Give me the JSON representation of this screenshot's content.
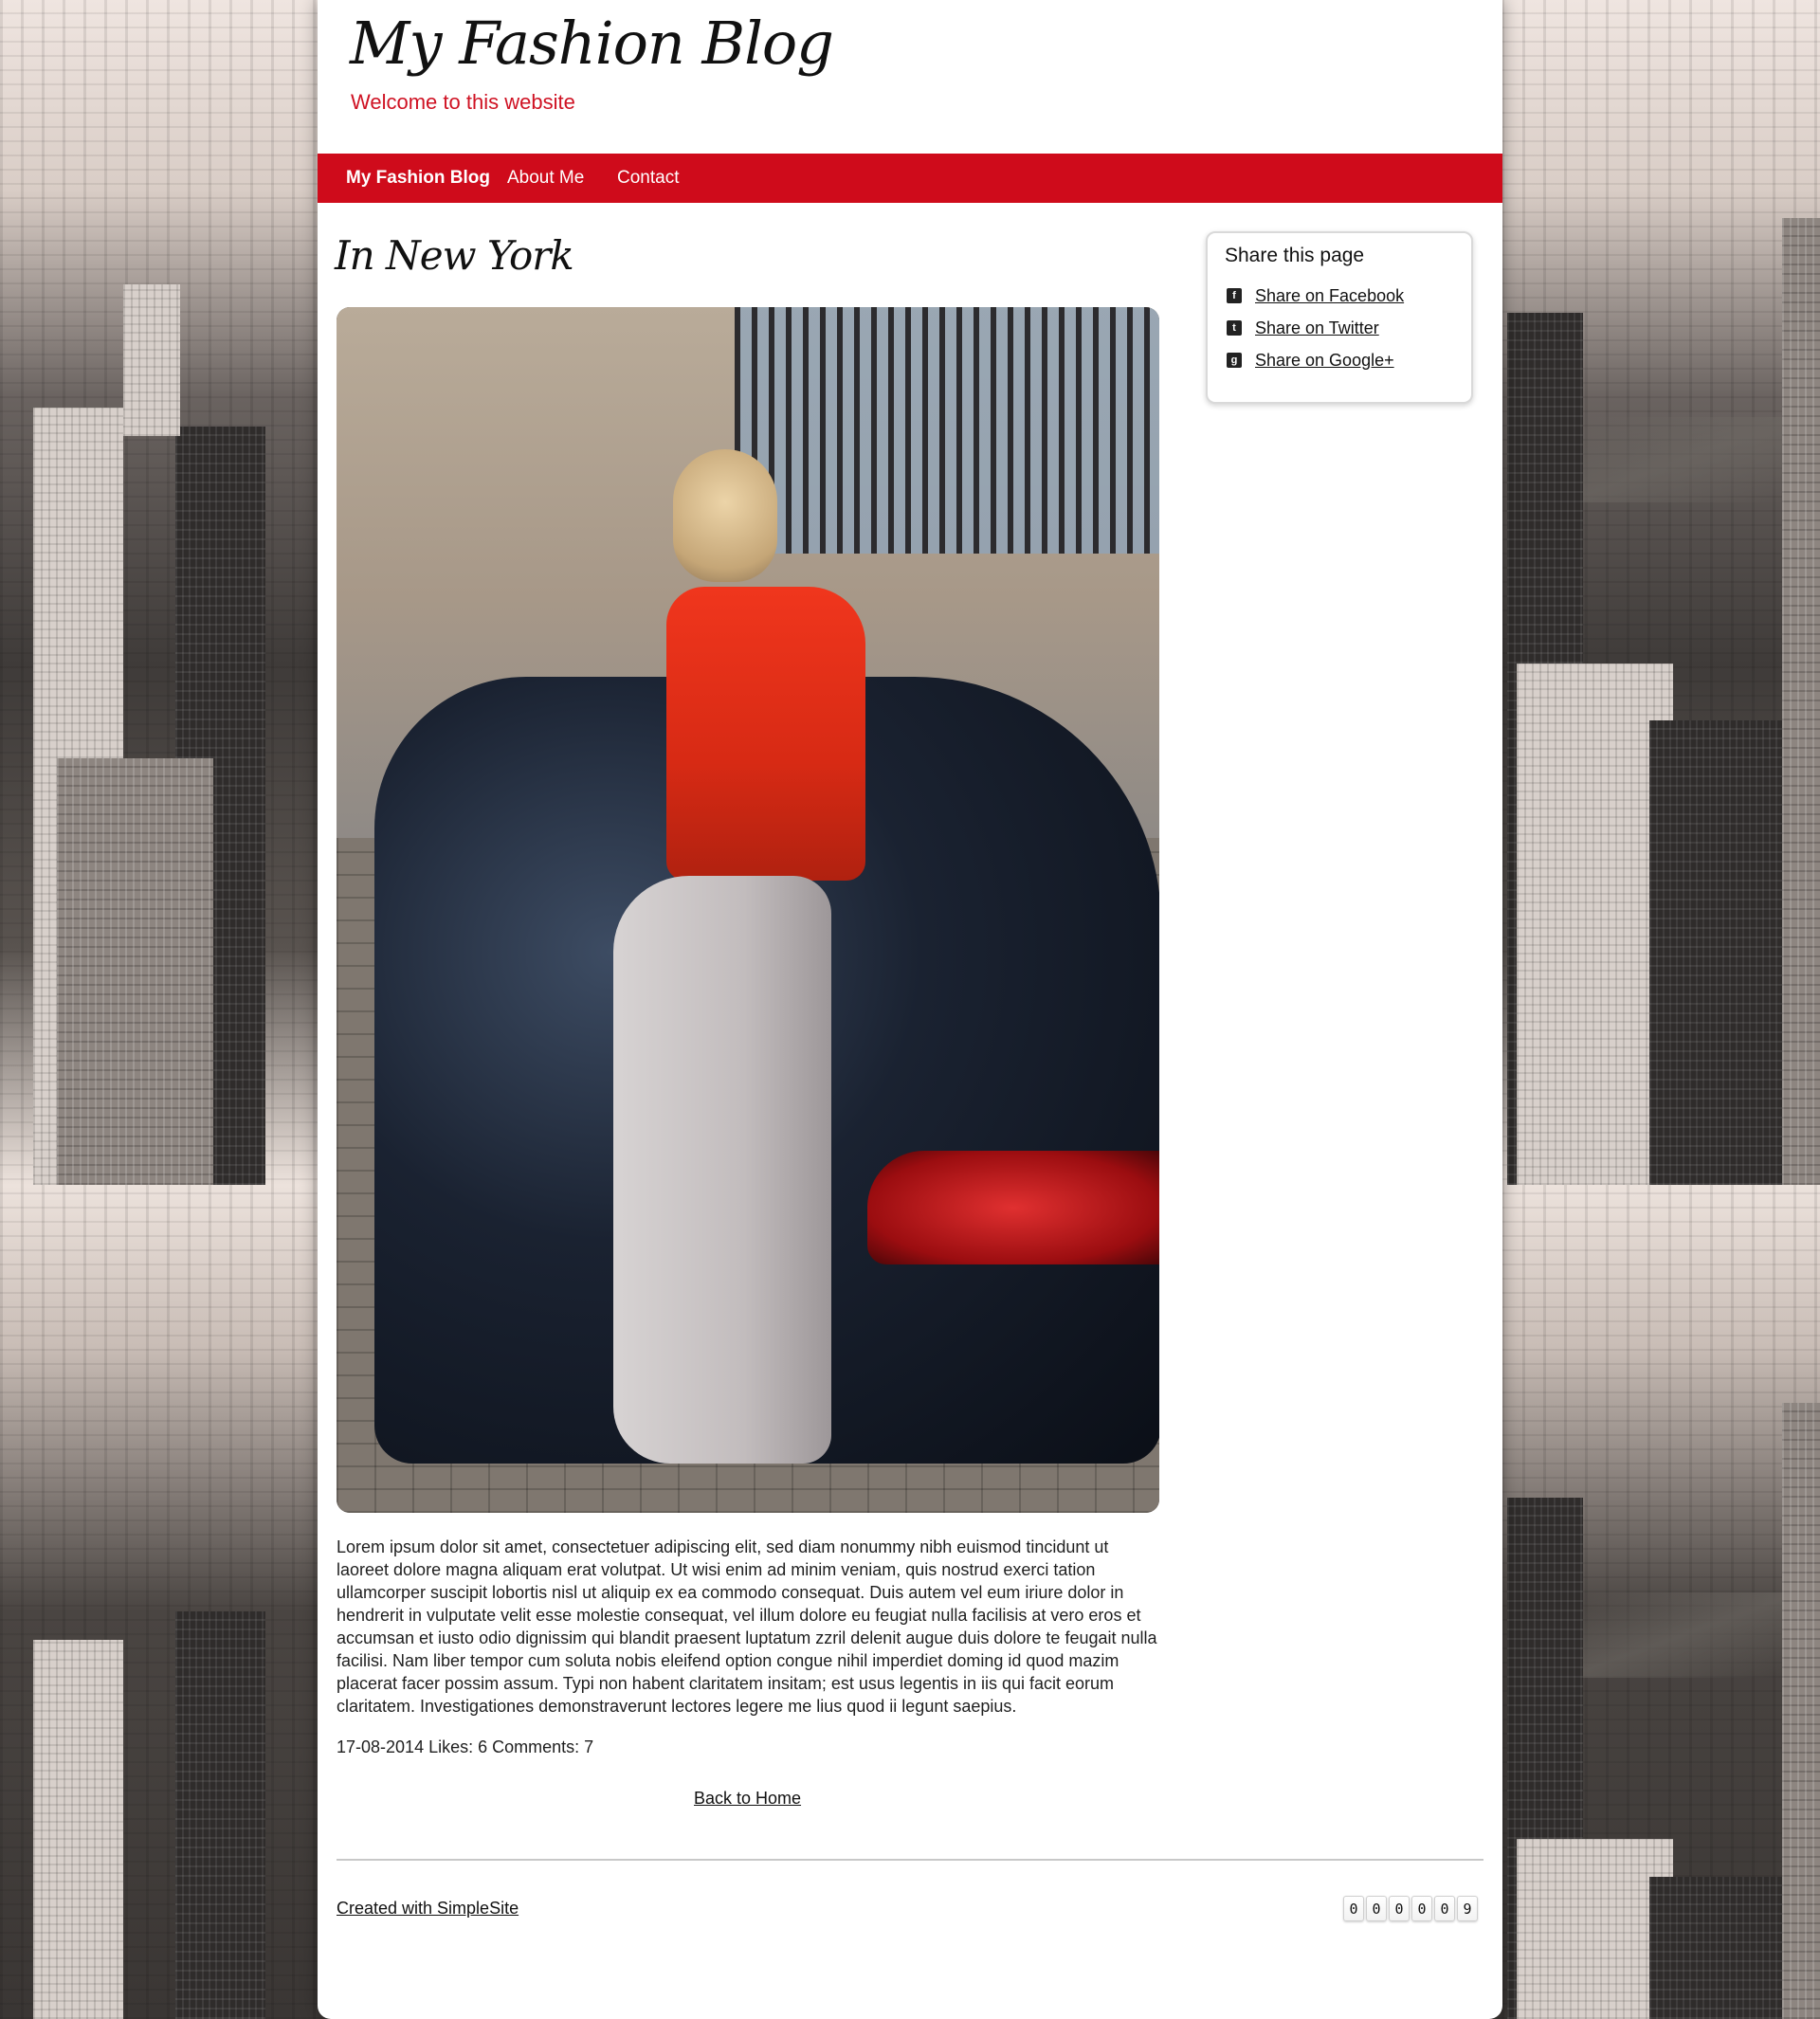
{
  "header": {
    "site_title": "My Fashion Blog",
    "subtitle": "Welcome to this website"
  },
  "nav": {
    "items": [
      {
        "label": "My Fashion Blog",
        "active": true
      },
      {
        "label": "About Me",
        "active": false
      },
      {
        "label": "Contact",
        "active": false
      }
    ]
  },
  "post": {
    "title": "In New York",
    "body": "Lorem ipsum dolor sit amet, consectetuer adipiscing elit, sed diam nonummy nibh euismod tincidunt ut laoreet dolore magna aliquam erat volutpat. Ut wisi enim ad minim veniam, quis nostrud exerci tation ullamcorper suscipit lobortis nisl ut aliquip ex ea commodo consequat. Duis autem vel eum iriure dolor in hendrerit in vulputate velit esse molestie consequat, vel illum dolore eu feugiat nulla facilisis at vero eros et accumsan et iusto odio dignissim qui blandit praesent luptatum zzril delenit augue duis dolore te feugait nulla facilisi. Nam liber tempor cum soluta nobis eleifend option congue nihil imperdiet doming id quod mazim placerat facer possim assum. Typi non habent claritatem insitam; est usus legentis in iis qui facit eorum claritatem. Investigationes demonstraverunt lectores legere me lius quod ii legunt saepius.",
    "meta": "17-08-2014 Likes: 6 Comments: 7",
    "back_link": "Back to Home"
  },
  "sidebar": {
    "share_title": "Share this page",
    "share_links": [
      {
        "label": "Share on Facebook",
        "icon": "facebook-icon"
      },
      {
        "label": "Share on Twitter",
        "icon": "twitter-icon"
      },
      {
        "label": "Share on Google+",
        "icon": "google-plus-icon"
      }
    ]
  },
  "footer": {
    "created_with": "Created with SimpleSite",
    "visitor_counter": [
      "0",
      "0",
      "0",
      "0",
      "0",
      "9"
    ]
  },
  "colors": {
    "brand_red": "#cf0b1b",
    "subtitle_red": "#cf1223",
    "text": "#1f1f1f"
  }
}
